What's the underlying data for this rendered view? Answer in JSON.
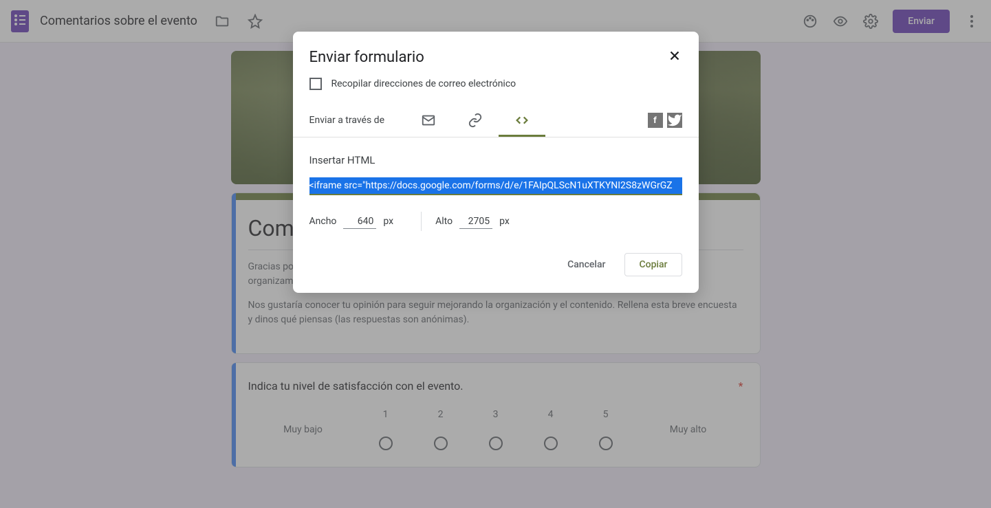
{
  "header": {
    "title": "Comentarios sobre el evento",
    "send_label": "Enviar"
  },
  "form": {
    "heading": "Com",
    "desc1_prefix": "Gracias po",
    "desc1_suffix": "organizamos.",
    "desc2": "Nos gustaría conocer tu opinión para seguir mejorando la organización y el contenido. Rellena esta breve encuesta y dinos qué piensas (las respuestas son anónimas)."
  },
  "question": {
    "text": "Indica tu nivel de satisfacción con el evento.",
    "required": "*",
    "low_label": "Muy bajo",
    "high_label": "Muy alto",
    "scale": [
      "1",
      "2",
      "3",
      "4",
      "5"
    ]
  },
  "dialog": {
    "title": "Enviar formulario",
    "checkbox_label": "Recopilar direcciones de correo electrónico",
    "send_via_label": "Enviar a través de",
    "embed_label": "Insertar HTML",
    "embed_code": "<iframe src=\"https://docs.google.com/forms/d/e/1FAIpQLScN1uXTKYNI2S8zWGrGZ",
    "width_label": "Ancho",
    "width_value": "640",
    "height_label": "Alto",
    "height_value": "2705",
    "px_unit": "px",
    "cancel_label": "Cancelar",
    "copy_label": "Copiar"
  }
}
